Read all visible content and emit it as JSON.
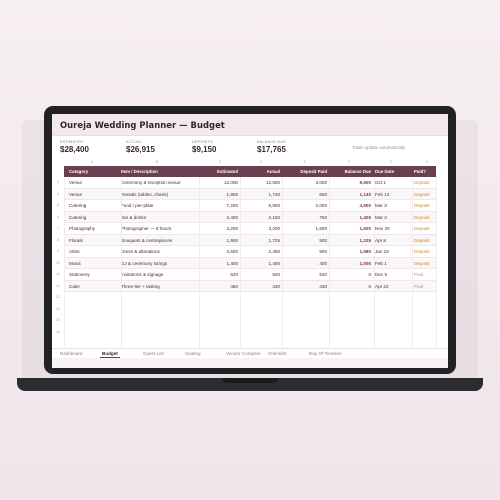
{
  "app": {
    "title": "Oureja Wedding Planner — Budget"
  },
  "kpis": {
    "estimated": {
      "label": "ESTIMATED",
      "value": "$28,400"
    },
    "actual": {
      "label": "ACTUAL",
      "value": "$26,915"
    },
    "deposits": {
      "label": "DEPOSITS",
      "value": "$9,150"
    },
    "balance": {
      "label": "BALANCE DUE",
      "value": "$17,765"
    },
    "note": "Totals update automatically"
  },
  "column_letters": [
    "A",
    "B",
    "C",
    "D",
    "E",
    "F",
    "G",
    "H"
  ],
  "table": {
    "headers": [
      "Category",
      "Item / Description",
      "Estimated",
      "Actual",
      "Deposit Paid",
      "Balance Due",
      "Due Date",
      "Paid?"
    ],
    "rows": [
      {
        "n": "3",
        "category": "Venue",
        "item": "Ceremony & reception venue",
        "estimated": "12,000",
        "actual": "12,500",
        "deposit": "3,000",
        "balance": "9,500",
        "due": "Oct 1",
        "paid": "Deposit"
      },
      {
        "n": "4",
        "category": "Venue",
        "item": "Rentals (tables, chairs)",
        "estimated": "1,800",
        "actual": "1,740",
        "deposit": "600",
        "balance": "1,140",
        "due": "Feb 12",
        "paid": "Deposit"
      },
      {
        "n": "5",
        "category": "Catering",
        "item": "Food / per-plate",
        "estimated": "7,200",
        "actual": "6,900",
        "deposit": "2,000",
        "balance": "4,900",
        "due": "Mar 3",
        "paid": "Deposit"
      },
      {
        "n": "6",
        "category": "Catering",
        "item": "Bar & drinks",
        "estimated": "2,400",
        "actual": "2,150",
        "deposit": "750",
        "balance": "1,400",
        "due": "Mar 3",
        "paid": "Deposit"
      },
      {
        "n": "7",
        "category": "Photography",
        "item": "Photographer — 8 hours",
        "estimated": "3,200",
        "actual": "3,200",
        "deposit": "1,600",
        "balance": "1,600",
        "due": "Nov 20",
        "paid": "Deposit"
      },
      {
        "n": "8",
        "category": "Florals",
        "item": "Bouquets & centrepieces",
        "estimated": "1,900",
        "actual": "1,725",
        "deposit": "500",
        "balance": "1,225",
        "due": "Apr 8",
        "paid": "Deposit"
      },
      {
        "n": "9",
        "category": "Attire",
        "item": "Dress & alterations",
        "estimated": "2,600",
        "actual": "2,480",
        "deposit": "900",
        "balance": "1,580",
        "due": "Jan 15",
        "paid": "Deposit"
      },
      {
        "n": "10",
        "category": "Music",
        "item": "DJ & ceremony strings",
        "estimated": "1,400",
        "actual": "1,400",
        "deposit": "400",
        "balance": "1,000",
        "due": "Feb 1",
        "paid": "Deposit"
      },
      {
        "n": "11",
        "category": "Stationery",
        "item": "Invitations & signage",
        "estimated": "620",
        "actual": "540",
        "deposit": "540",
        "balance": "0",
        "due": "Dec 5",
        "paid": "Paid"
      },
      {
        "n": "12",
        "category": "Cake",
        "item": "Three-tier + tasting",
        "estimated": "480",
        "actual": "430",
        "deposit": "430",
        "balance": "0",
        "due": "Apr 22",
        "paid": "Paid"
      }
    ],
    "extra_row_numbers": [
      "13",
      "14",
      "15",
      "16",
      "17",
      "18",
      "19",
      "20",
      "21",
      "22",
      "23",
      "24",
      "25"
    ]
  },
  "tabs": [
    {
      "label": "Dashboard",
      "active": false
    },
    {
      "label": "Budget",
      "active": true
    },
    {
      "label": "Guest List",
      "active": false
    },
    {
      "label": "Seating",
      "active": false
    },
    {
      "label": "Vendor Compare",
      "active": false
    },
    {
      "label": "Checklist",
      "active": false
    },
    {
      "label": "Day Of Timeline",
      "active": false
    }
  ],
  "colors": {
    "accent": "#6b3f52",
    "balance_text": "#7a3a52",
    "deposit_status": "#c48a3a",
    "paid_status": "#a89aa1"
  }
}
